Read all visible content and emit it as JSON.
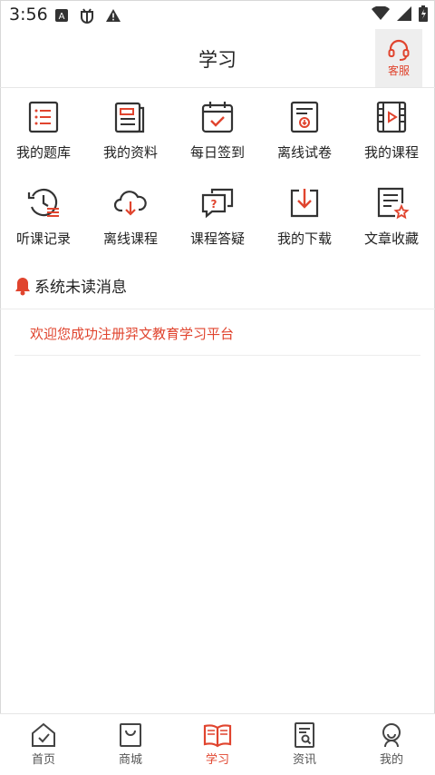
{
  "status_bar": {
    "time": "3:56",
    "icons": [
      "a-icon",
      "bug-icon",
      "warning-icon",
      "wifi-icon",
      "signal-icon",
      "battery-icon"
    ]
  },
  "header": {
    "title": "学习",
    "customer_service_label": "客服"
  },
  "grid": [
    {
      "label": "我的题库",
      "icon": "question-bank-icon"
    },
    {
      "label": "我的资料",
      "icon": "materials-icon"
    },
    {
      "label": "每日签到",
      "icon": "calendar-check-icon"
    },
    {
      "label": "离线试卷",
      "icon": "offline-paper-icon"
    },
    {
      "label": "我的课程",
      "icon": "course-video-icon"
    },
    {
      "label": "听课记录",
      "icon": "history-icon"
    },
    {
      "label": "离线课程",
      "icon": "cloud-download-icon"
    },
    {
      "label": "课程答疑",
      "icon": "qa-chat-icon"
    },
    {
      "label": "我的下载",
      "icon": "download-icon"
    },
    {
      "label": "文章收藏",
      "icon": "article-star-icon"
    }
  ],
  "notices": {
    "title": "系统未读消息",
    "items": [
      "欢迎您成功注册羿文教育学习平台"
    ]
  },
  "tabbar": [
    {
      "label": "首页",
      "icon": "home-icon",
      "active": false
    },
    {
      "label": "商城",
      "icon": "shop-bag-icon",
      "active": false
    },
    {
      "label": "学习",
      "icon": "book-icon",
      "active": true
    },
    {
      "label": "资讯",
      "icon": "news-icon",
      "active": false
    },
    {
      "label": "我的",
      "icon": "profile-icon",
      "active": false
    }
  ],
  "colors": {
    "accent": "#e0442e",
    "icon_dark": "#333333"
  }
}
